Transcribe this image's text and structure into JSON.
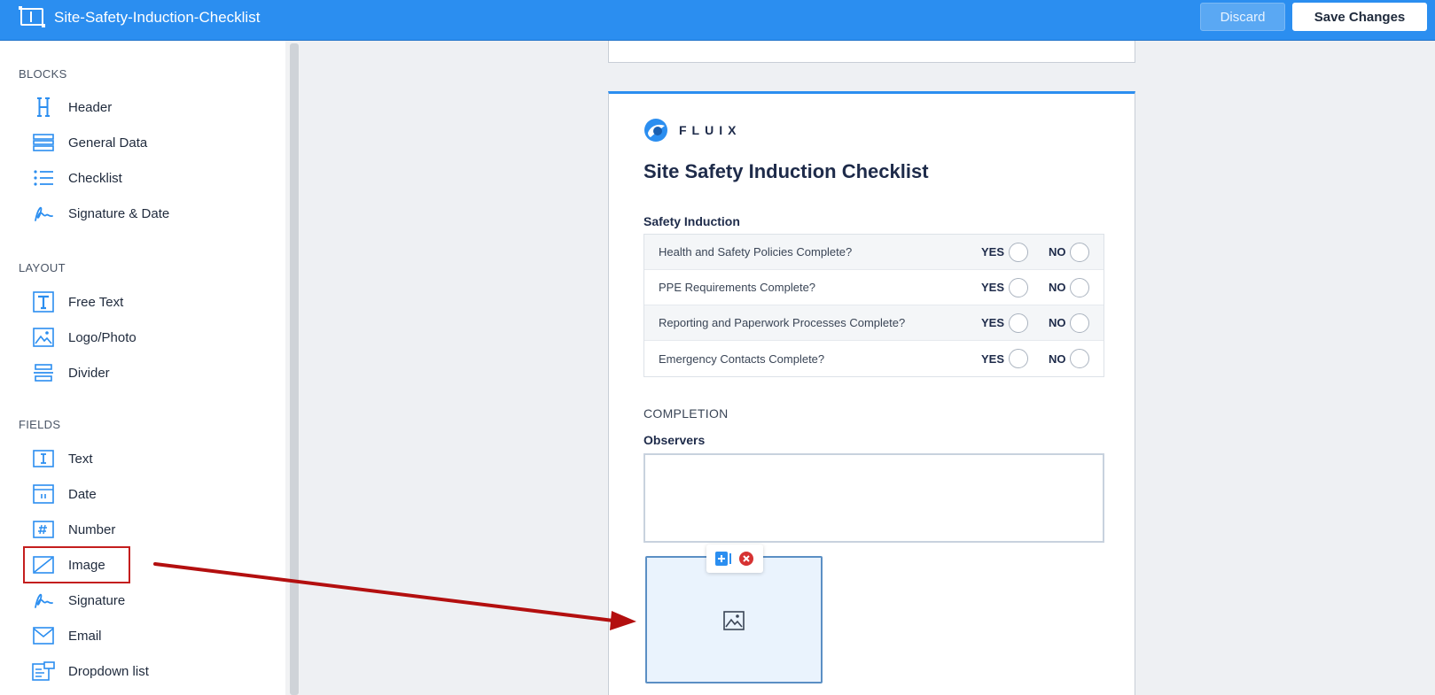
{
  "header": {
    "title": "Site-Safety-Induction-Checklist",
    "discard_label": "Discard",
    "save_label": "Save Changes",
    "brand_color": "#2b8ef0"
  },
  "sidebar": {
    "sections": {
      "blocks": "BLOCKS",
      "layout": "LAYOUT",
      "fields": "FIELDS"
    },
    "blocks": [
      {
        "label": "Header",
        "icon": "header-icon"
      },
      {
        "label": "General Data",
        "icon": "general-data-icon"
      },
      {
        "label": "Checklist",
        "icon": "checklist-icon"
      },
      {
        "label": "Signature & Date",
        "icon": "signature-icon"
      }
    ],
    "layout": [
      {
        "label": "Free Text",
        "icon": "free-text-icon"
      },
      {
        "label": "Logo/Photo",
        "icon": "photo-icon"
      },
      {
        "label": "Divider",
        "icon": "divider-icon"
      }
    ],
    "fields": [
      {
        "label": "Text",
        "icon": "text-field-icon"
      },
      {
        "label": "Date",
        "icon": "calendar-icon"
      },
      {
        "label": "Number",
        "icon": "hash-icon"
      },
      {
        "label": "Image",
        "icon": "image-field-icon"
      },
      {
        "label": "Signature",
        "icon": "signature-icon"
      },
      {
        "label": "Email",
        "icon": "envelope-icon"
      },
      {
        "label": "Dropdown list",
        "icon": "dropdown-list-icon"
      }
    ]
  },
  "form": {
    "brand": "FLUIX",
    "title": "Site Safety Induction Checklist",
    "section": "Safety Induction",
    "yes_label": "YES",
    "no_label": "NO",
    "questions": [
      "Health and Safety Policies Complete?",
      "PPE Requirements Complete?",
      "Reporting and Paperwork Processes Complete?",
      "Emergency Contacts Complete?"
    ],
    "completion_label": "COMPLETION",
    "observers_label": "Observers"
  },
  "annotation": {
    "color": "#b30f0f"
  }
}
